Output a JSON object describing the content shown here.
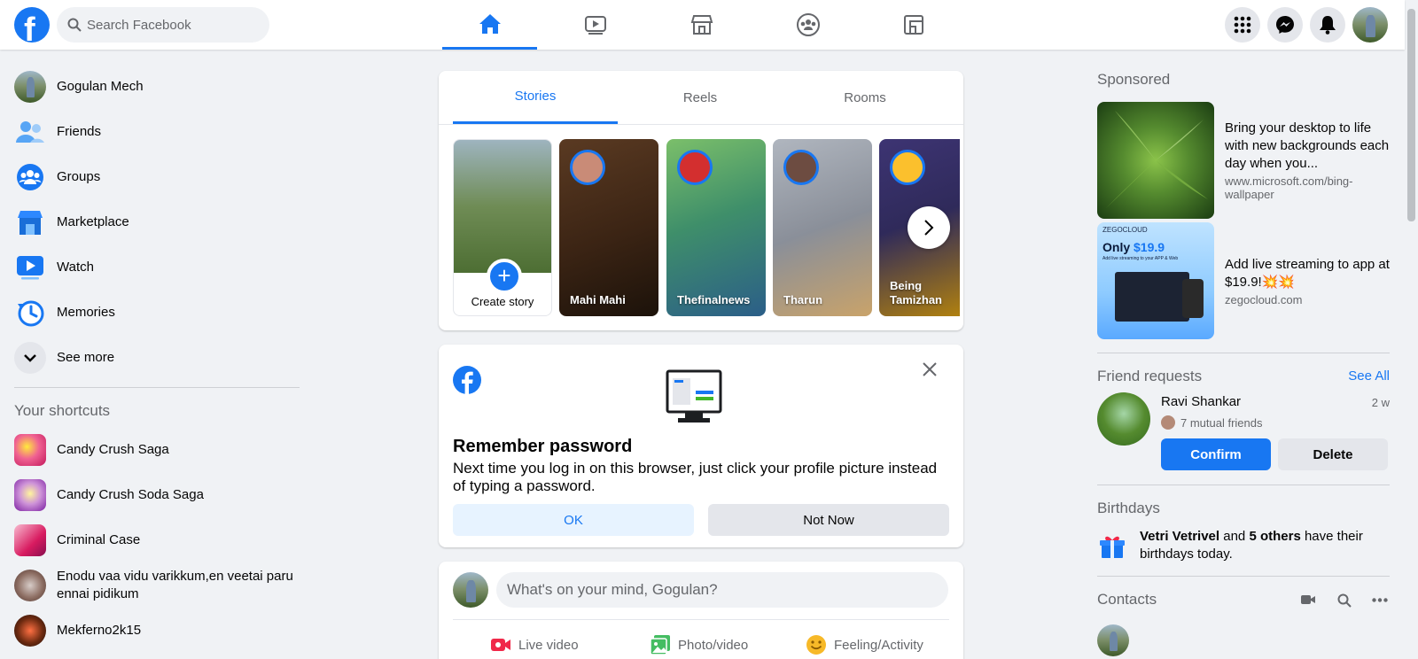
{
  "header": {
    "search_placeholder": "Search Facebook",
    "nav": [
      "Home",
      "Watch",
      "Marketplace",
      "Groups",
      "Gaming"
    ]
  },
  "sidebar": {
    "items": [
      {
        "label": "Gogulan Mech",
        "icon": "profile-avatar"
      },
      {
        "label": "Friends",
        "icon": "friends-icon"
      },
      {
        "label": "Groups",
        "icon": "groups-icon"
      },
      {
        "label": "Marketplace",
        "icon": "marketplace-icon"
      },
      {
        "label": "Watch",
        "icon": "watch-icon"
      },
      {
        "label": "Memories",
        "icon": "memories-icon"
      },
      {
        "label": "See more",
        "icon": "chevron-down-icon"
      }
    ],
    "shortcuts_title": "Your shortcuts",
    "shortcuts": [
      {
        "label": "Candy Crush Saga",
        "color": "#c2185b"
      },
      {
        "label": "Candy Crush Soda Saga",
        "color": "#7b1fa2"
      },
      {
        "label": "Criminal Case",
        "color": "#d81b60"
      },
      {
        "label": "Enodu vaa vidu varikkum,en veetai paru ennai pidikum",
        "color": "#5d4037"
      },
      {
        "label": "Mekferno2k15",
        "color": "#3e2723"
      }
    ]
  },
  "stories": {
    "tabs": [
      "Stories",
      "Reels",
      "Rooms"
    ],
    "create_label": "Create story",
    "items": [
      {
        "name": "Mahi Mahi",
        "color": "#3b2414"
      },
      {
        "name": "Thefinalnews",
        "color": "#3f8f6a"
      },
      {
        "name": "Tharun",
        "color": "#8a8f99"
      },
      {
        "name": "Being Tamizhan",
        "color": "#2f2a5a"
      }
    ]
  },
  "remember": {
    "title": "Remember password",
    "text": "Next time you log in on this browser, just click your profile picture instead of typing a password.",
    "ok": "OK",
    "not_now": "Not Now"
  },
  "composer": {
    "placeholder": "What's on your mind, Gogulan?",
    "actions": [
      "Live video",
      "Photo/video",
      "Feeling/Activity"
    ]
  },
  "right": {
    "sponsored": "Sponsored",
    "ads": [
      {
        "title": "Bring your desktop to life with new backgrounds each day when you...",
        "url": "www.microsoft.com/bing-wallpaper"
      },
      {
        "title": "Add live streaming to app at $19.9!💥💥",
        "url": "zegocloud.com",
        "badge_brand": "ZEGOCLOUD",
        "badge_prefix": "Only",
        "badge_price": "$19.9",
        "badge_sub": "Add live streaming to your APP & Web"
      }
    ],
    "friend_requests": "Friend requests",
    "see_all": "See All",
    "request": {
      "name": "Ravi Shankar",
      "time": "2 w",
      "mutual": "7 mutual friends",
      "confirm": "Confirm",
      "delete": "Delete"
    },
    "birthdays": "Birthdays",
    "birthday_name": "Vetri Vetrivel",
    "birthday_and": "and",
    "birthday_others": "5 others",
    "birthday_rest": "have their birthdays today.",
    "contacts": "Contacts"
  }
}
